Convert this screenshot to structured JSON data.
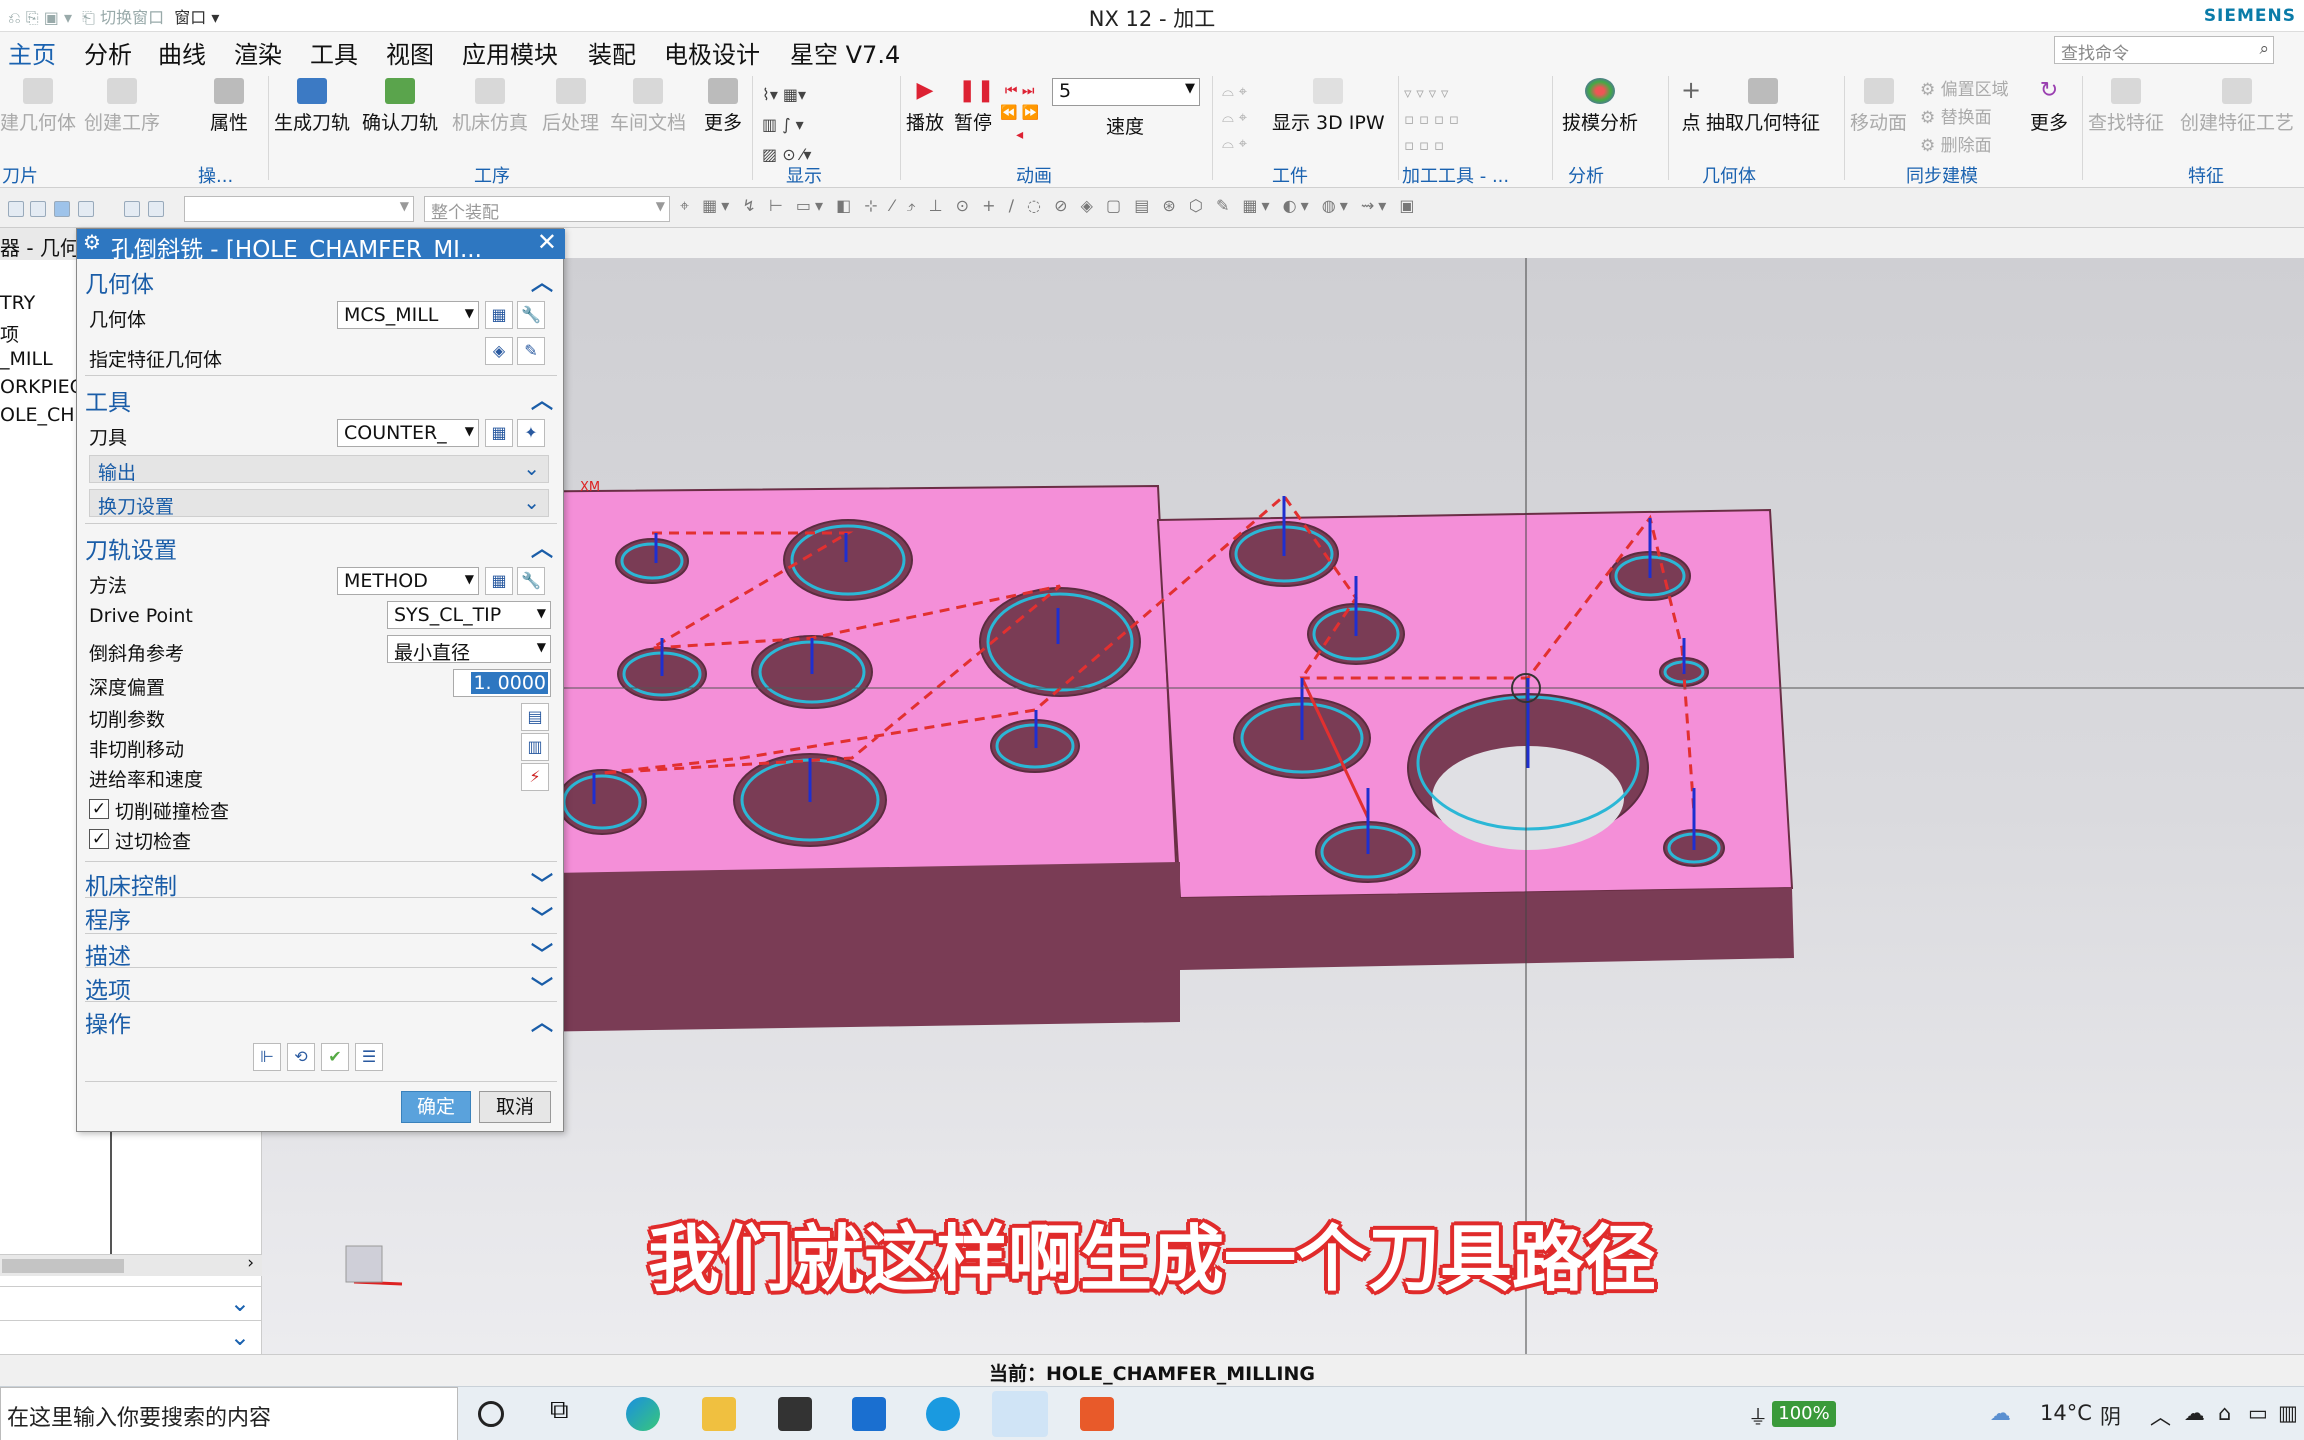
{
  "titlebar": {
    "qat_text": "切换窗口",
    "window_menu": "窗口",
    "title": "NX 12 - 加工",
    "brand": "SIEMENS"
  },
  "menu": {
    "tabs": [
      "主页",
      "分析",
      "曲线",
      "渲染",
      "工具",
      "视图",
      "应用模块",
      "装配",
      "电极设计",
      "星空 V7.4"
    ],
    "active_index": 0,
    "search_placeholder": "查找命令"
  },
  "ribbon": {
    "buttons": {
      "create_geometry": "建几何体",
      "create_operation": "创建工序",
      "properties": "属性",
      "generate_toolpath": "生成刀轨",
      "verify_toolpath": "确认刀轨",
      "machine_sim": "机床仿真",
      "postprocess": "后处理",
      "shop_docs": "车间文档",
      "more1": "更多",
      "play": "播放",
      "pause": "暂停",
      "speed_value": "5",
      "speed_label": "速度",
      "show_3d_ipw": "显示 3D IPW",
      "draft_analysis": "拔模分析",
      "point": "点",
      "extract_geometry": "抽取几何特征",
      "move_face": "移动面",
      "offset_region": "偏置区域",
      "replace_face": "替换面",
      "delete_face": "删除面",
      "more2": "更多",
      "find_feature": "查找特征",
      "create_feature_process": "创建特征工艺"
    },
    "groups": {
      "tool": "刀片",
      "ops": "操...",
      "operation": "工序",
      "display": "显示",
      "animation": "动画",
      "workpiece": "工件",
      "machining_tool": "加工工具 - ...",
      "analysis": "分析",
      "geometry": "几何体",
      "sync_modeling": "同步建模",
      "feature": "特征"
    }
  },
  "toolbar2": {
    "assembly_placeholder": "整个装配"
  },
  "navigator": {
    "header": "器 - 几何",
    "rows": [
      "TRY",
      "项",
      "_MILL",
      "ORKPIEC",
      "OLE_CH"
    ]
  },
  "dialog": {
    "title": "孔倒斜铣 - [HOLE_CHAMFER_MI...",
    "sections": {
      "geometry": "几何体",
      "tool": "工具",
      "path": "刀轨设置",
      "machine": "机床控制",
      "program": "程序",
      "description": "描述",
      "options": "选项",
      "actions": "操作"
    },
    "geometry_label": "几何体",
    "geometry_value": "MCS_MILL",
    "feature_geometry_label": "指定特征几何体",
    "tool_label": "刀具",
    "tool_value": "COUNTER_",
    "output_label": "输出",
    "tool_change_label": "换刀设置",
    "method_label": "方法",
    "method_value": "METHOD",
    "drive_point_label": "Drive Point",
    "drive_point_value": "SYS_CL_TIP",
    "chamfer_ref_label": "倒斜角参考",
    "chamfer_ref_value": "最小直径",
    "depth_offset_label": "深度偏置",
    "depth_offset_value": "1. 0000",
    "cut_params_label": "切削参数",
    "non_cut_label": "非切削移动",
    "feeds_label": "进给率和速度",
    "collision_check_label": "切削碰撞检查",
    "gouge_check_label": "过切检查",
    "ok": "确定",
    "cancel": "取消"
  },
  "viewport": {
    "axis_label": "XM"
  },
  "subtitle": "我们就这样啊生成一个刀具路径",
  "status": {
    "current": "当前：HOLE_CHAMFER_MILLING"
  },
  "taskbar": {
    "search_placeholder": "在这里输入你要搜索的内容",
    "battery": "100%",
    "temperature": "14°C",
    "weather": "阴"
  },
  "colors": {
    "accent": "#2e77c1",
    "part_pink": "#f48fd8",
    "part_side": "#7a3c55",
    "toolpath": "#e23030"
  }
}
